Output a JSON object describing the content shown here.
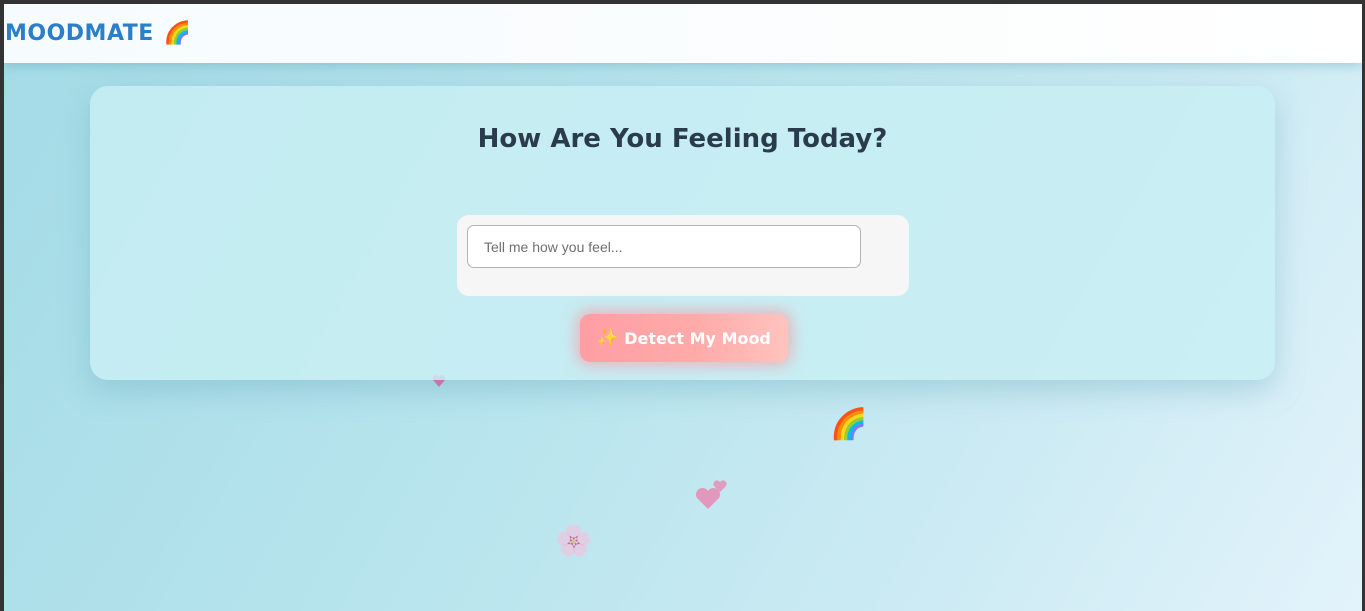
{
  "navbar": {
    "brand": "MOODMATE",
    "brand_icon": "🌈"
  },
  "main": {
    "title": "How Are You Feeling Today?",
    "input": {
      "placeholder": "Tell me how you feel...",
      "value": ""
    },
    "button": {
      "icon": "✨",
      "label": "Detect My Mood"
    }
  },
  "decorations": {
    "rainbow": "🌈",
    "flower": "🌸"
  },
  "colors": {
    "brand": "#2b7ec8",
    "button_start": "#ff9ea3",
    "button_end": "#ffc3be",
    "title": "#2a3c4b"
  }
}
